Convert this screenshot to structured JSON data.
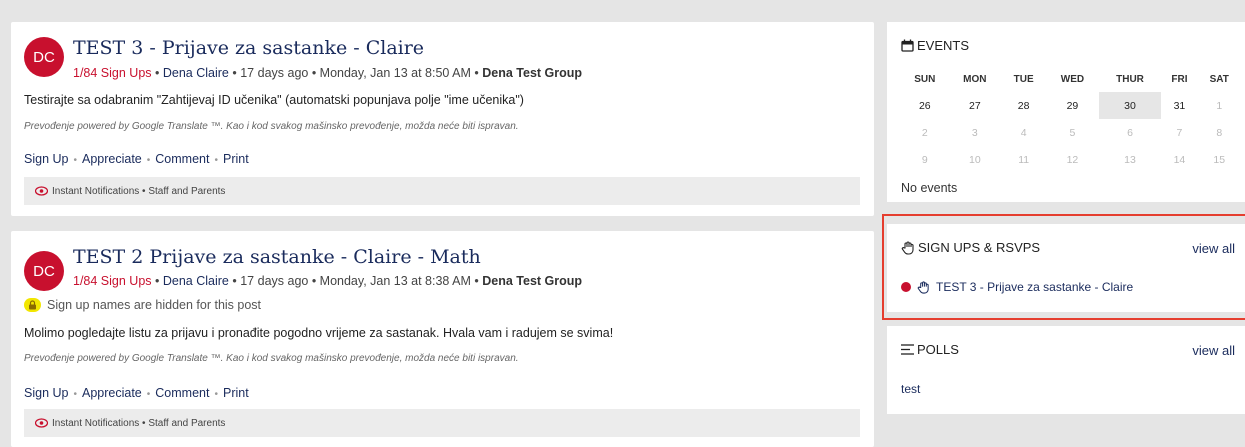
{
  "posts": [
    {
      "avatar": "DC",
      "title": "TEST 3 - Prijave za sastanke - Claire",
      "signups": "1/84 Sign Ups",
      "author": "Dena Claire",
      "date": "17 days ago • Monday, Jan 13 at 8:50 AM",
      "group": "Dena Test Group",
      "body": "Testirajte sa odabranim \"Zahtijevaj ID učenika\" (automatski popunjava polje \"ime učenika\")",
      "translate": "Prevođenje powered by Google Translate ™. Kao i kod svakog mašinsko prevođenje, možda neće biti ispravan.",
      "actions": {
        "signup": "Sign Up",
        "appreciate": "Appreciate",
        "comment": "Comment",
        "print": "Print"
      },
      "notify": "Instant Notifications • Staff and Parents"
    },
    {
      "avatar": "DC",
      "title": "TEST 2 Prijave za sastanke - Claire - Math",
      "signups": "1/84 Sign Ups",
      "author": "Dena Claire",
      "date": "17 days ago • Monday, Jan 13 at 8:38 AM",
      "group": "Dena Test Group",
      "hidden_note": "Sign up names are hidden for this post",
      "body": "Molimo pogledajte listu za prijavu i pronađite pogodno vrijeme za sastanak. Hvala vam i radujem se svima!",
      "translate": "Prevođenje powered by Google Translate ™. Kao i kod svakog mašinsko prevođenje, možda neće biti ispravan.",
      "actions": {
        "signup": "Sign Up",
        "appreciate": "Appreciate",
        "comment": "Comment",
        "print": "Print"
      },
      "notify": "Instant Notifications • Staff and Parents"
    }
  ],
  "events": {
    "title": "EVENTS",
    "days": [
      "SUN",
      "MON",
      "TUE",
      "WED",
      "THUR",
      "FRI",
      "SAT"
    ],
    "weeks": [
      [
        "26",
        "27",
        "28",
        "29",
        "30",
        "31",
        "1"
      ],
      [
        "2",
        "3",
        "4",
        "5",
        "6",
        "7",
        "8"
      ],
      [
        "9",
        "10",
        "11",
        "12",
        "13",
        "14",
        "15"
      ]
    ],
    "no_events": "No events"
  },
  "signups_card": {
    "title": "SIGN UPS & RSVPS",
    "view_all": "view all",
    "item": "TEST 3 - Prijave za sastanke - Claire"
  },
  "polls": {
    "title": "POLLS",
    "view_all": "view all",
    "item": "test"
  },
  "colors": {
    "brand_red": "#c8102e",
    "navy": "#1a2b5c",
    "highlight": "#e53e2f"
  }
}
